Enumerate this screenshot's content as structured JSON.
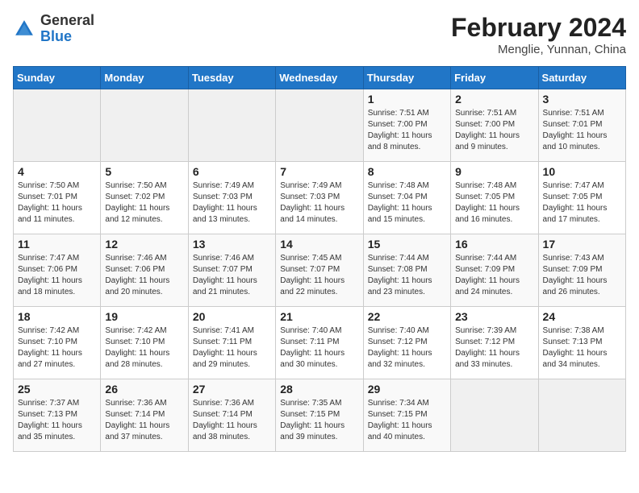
{
  "header": {
    "logo_general": "General",
    "logo_blue": "Blue",
    "month_year": "February 2024",
    "location": "Menglie, Yunnan, China"
  },
  "weekdays": [
    "Sunday",
    "Monday",
    "Tuesday",
    "Wednesday",
    "Thursday",
    "Friday",
    "Saturday"
  ],
  "weeks": [
    [
      {
        "day": "",
        "empty": true
      },
      {
        "day": "",
        "empty": true
      },
      {
        "day": "",
        "empty": true
      },
      {
        "day": "",
        "empty": true
      },
      {
        "day": "1",
        "sunrise": "7:51 AM",
        "sunset": "7:00 PM",
        "daylight": "11 hours and 8 minutes."
      },
      {
        "day": "2",
        "sunrise": "7:51 AM",
        "sunset": "7:00 PM",
        "daylight": "11 hours and 9 minutes."
      },
      {
        "day": "3",
        "sunrise": "7:51 AM",
        "sunset": "7:01 PM",
        "daylight": "11 hours and 10 minutes."
      }
    ],
    [
      {
        "day": "4",
        "sunrise": "7:50 AM",
        "sunset": "7:01 PM",
        "daylight": "11 hours and 11 minutes."
      },
      {
        "day": "5",
        "sunrise": "7:50 AM",
        "sunset": "7:02 PM",
        "daylight": "11 hours and 12 minutes."
      },
      {
        "day": "6",
        "sunrise": "7:49 AM",
        "sunset": "7:03 PM",
        "daylight": "11 hours and 13 minutes."
      },
      {
        "day": "7",
        "sunrise": "7:49 AM",
        "sunset": "7:03 PM",
        "daylight": "11 hours and 14 minutes."
      },
      {
        "day": "8",
        "sunrise": "7:48 AM",
        "sunset": "7:04 PM",
        "daylight": "11 hours and 15 minutes."
      },
      {
        "day": "9",
        "sunrise": "7:48 AM",
        "sunset": "7:05 PM",
        "daylight": "11 hours and 16 minutes."
      },
      {
        "day": "10",
        "sunrise": "7:47 AM",
        "sunset": "7:05 PM",
        "daylight": "11 hours and 17 minutes."
      }
    ],
    [
      {
        "day": "11",
        "sunrise": "7:47 AM",
        "sunset": "7:06 PM",
        "daylight": "11 hours and 18 minutes."
      },
      {
        "day": "12",
        "sunrise": "7:46 AM",
        "sunset": "7:06 PM",
        "daylight": "11 hours and 20 minutes."
      },
      {
        "day": "13",
        "sunrise": "7:46 AM",
        "sunset": "7:07 PM",
        "daylight": "11 hours and 21 minutes."
      },
      {
        "day": "14",
        "sunrise": "7:45 AM",
        "sunset": "7:07 PM",
        "daylight": "11 hours and 22 minutes."
      },
      {
        "day": "15",
        "sunrise": "7:44 AM",
        "sunset": "7:08 PM",
        "daylight": "11 hours and 23 minutes."
      },
      {
        "day": "16",
        "sunrise": "7:44 AM",
        "sunset": "7:09 PM",
        "daylight": "11 hours and 24 minutes."
      },
      {
        "day": "17",
        "sunrise": "7:43 AM",
        "sunset": "7:09 PM",
        "daylight": "11 hours and 26 minutes."
      }
    ],
    [
      {
        "day": "18",
        "sunrise": "7:42 AM",
        "sunset": "7:10 PM",
        "daylight": "11 hours and 27 minutes."
      },
      {
        "day": "19",
        "sunrise": "7:42 AM",
        "sunset": "7:10 PM",
        "daylight": "11 hours and 28 minutes."
      },
      {
        "day": "20",
        "sunrise": "7:41 AM",
        "sunset": "7:11 PM",
        "daylight": "11 hours and 29 minutes."
      },
      {
        "day": "21",
        "sunrise": "7:40 AM",
        "sunset": "7:11 PM",
        "daylight": "11 hours and 30 minutes."
      },
      {
        "day": "22",
        "sunrise": "7:40 AM",
        "sunset": "7:12 PM",
        "daylight": "11 hours and 32 minutes."
      },
      {
        "day": "23",
        "sunrise": "7:39 AM",
        "sunset": "7:12 PM",
        "daylight": "11 hours and 33 minutes."
      },
      {
        "day": "24",
        "sunrise": "7:38 AM",
        "sunset": "7:13 PM",
        "daylight": "11 hours and 34 minutes."
      }
    ],
    [
      {
        "day": "25",
        "sunrise": "7:37 AM",
        "sunset": "7:13 PM",
        "daylight": "11 hours and 35 minutes."
      },
      {
        "day": "26",
        "sunrise": "7:36 AM",
        "sunset": "7:14 PM",
        "daylight": "11 hours and 37 minutes."
      },
      {
        "day": "27",
        "sunrise": "7:36 AM",
        "sunset": "7:14 PM",
        "daylight": "11 hours and 38 minutes."
      },
      {
        "day": "28",
        "sunrise": "7:35 AM",
        "sunset": "7:15 PM",
        "daylight": "11 hours and 39 minutes."
      },
      {
        "day": "29",
        "sunrise": "7:34 AM",
        "sunset": "7:15 PM",
        "daylight": "11 hours and 40 minutes."
      },
      {
        "day": "",
        "empty": true
      },
      {
        "day": "",
        "empty": true
      }
    ]
  ]
}
